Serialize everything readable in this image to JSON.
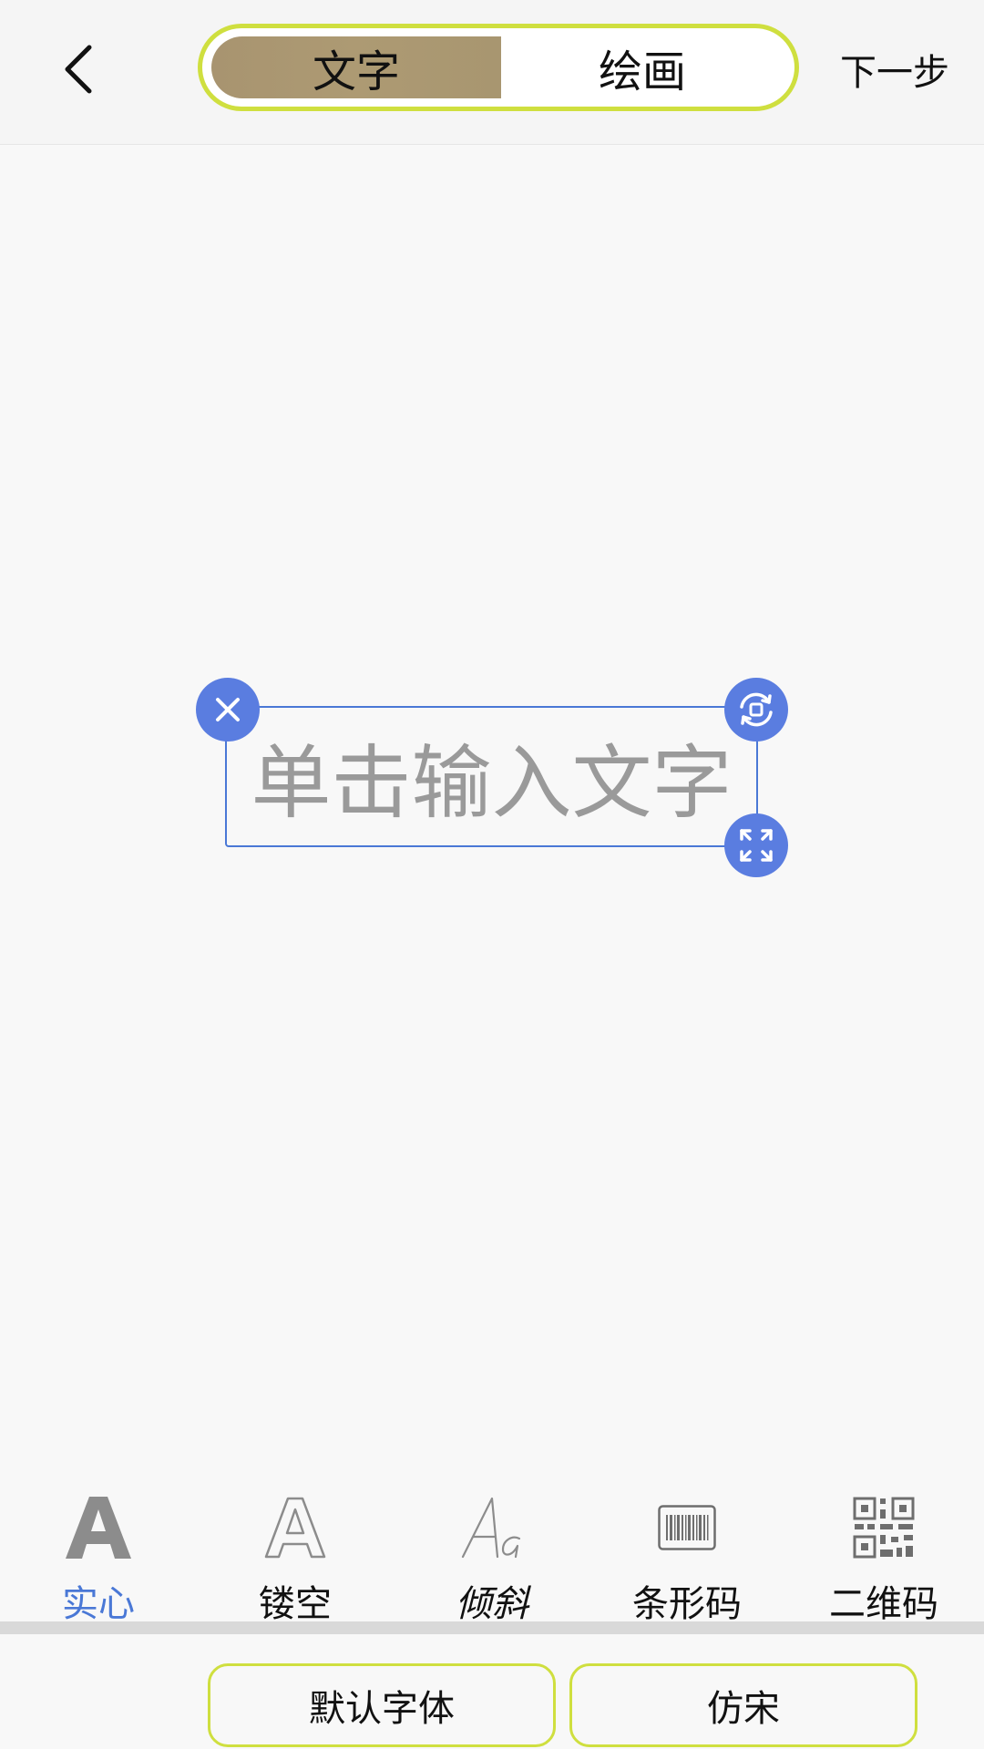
{
  "header": {
    "back_icon": "chevron-left-icon",
    "tabs": [
      {
        "label": "文字",
        "active": true
      },
      {
        "label": "绘画",
        "active": false
      }
    ],
    "next_label": "下一步",
    "toggle_border_color": "#cfdf3f",
    "active_tab_color": "#a8966c"
  },
  "canvas": {
    "text_placeholder": "单击输入文字",
    "handle_color": "#5a7de0",
    "handles": [
      "close-icon",
      "rotate-icon",
      "scale-icon"
    ]
  },
  "styles": [
    {
      "label": "实心",
      "icon": "solid-a-icon",
      "active": true
    },
    {
      "label": "镂空",
      "icon": "outline-a-icon",
      "active": false
    },
    {
      "label": "倾斜",
      "icon": "italic-aa-icon",
      "active": false
    },
    {
      "label": "条形码",
      "icon": "barcode-icon",
      "active": false
    },
    {
      "label": "二维码",
      "icon": "qrcode-icon",
      "active": false
    }
  ],
  "fonts": [
    {
      "label": "默认字体"
    },
    {
      "label": "仿宋"
    }
  ],
  "accent_color": "#4a78d6"
}
